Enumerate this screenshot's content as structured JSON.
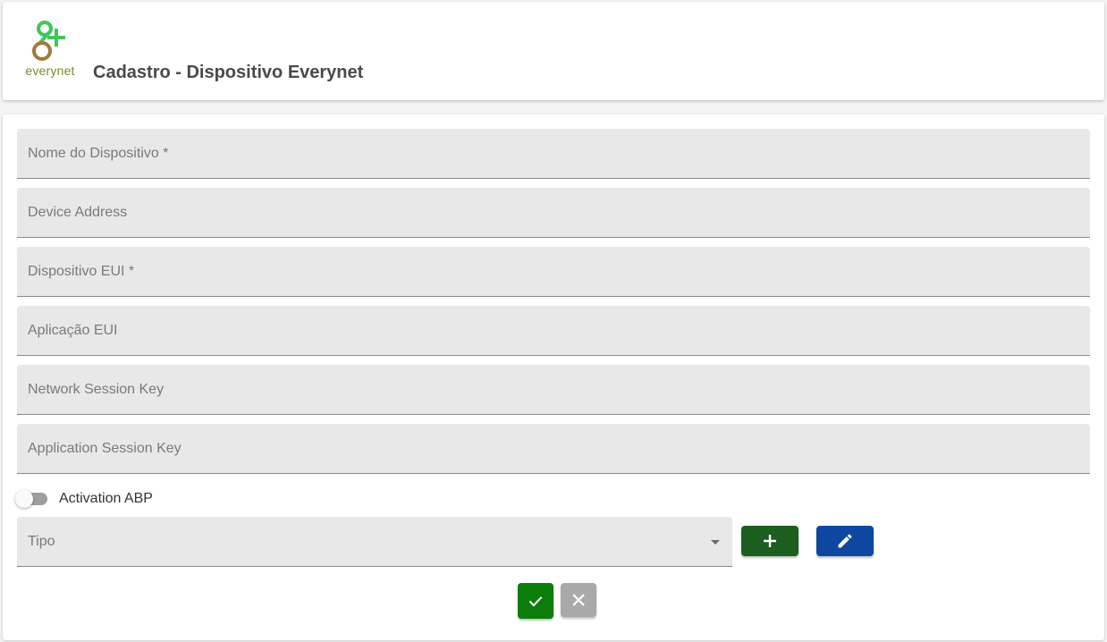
{
  "header": {
    "logo_text": "everynet",
    "title": "Cadastro - Dispositivo Everynet"
  },
  "form": {
    "fields": [
      {
        "placeholder": "Nome do Dispositivo *",
        "value": ""
      },
      {
        "placeholder": "Device Address",
        "value": ""
      },
      {
        "placeholder": "Dispositivo EUI *",
        "value": ""
      },
      {
        "placeholder": "Aplicação EUI",
        "value": ""
      },
      {
        "placeholder": "Network Session Key",
        "value": ""
      },
      {
        "placeholder": "Application Session Key",
        "value": ""
      }
    ],
    "toggle": {
      "label": "Activation ABP",
      "checked": false
    },
    "select": {
      "placeholder": "Tipo",
      "value": ""
    }
  },
  "icons": {
    "logo": "everynet-logo-icon",
    "add": "plus-icon",
    "edit": "pencil-icon",
    "confirm": "check-icon",
    "cancel": "close-icon",
    "select": "dropdown-arrow-icon"
  },
  "colors": {
    "logo_green": "#3cc85a",
    "logo_brown": "#a07a3a",
    "add_button": "#1b5e20",
    "edit_button": "#0d47a1",
    "confirm_button": "#0a7d0a",
    "cancel_button": "#a9a9a9"
  }
}
